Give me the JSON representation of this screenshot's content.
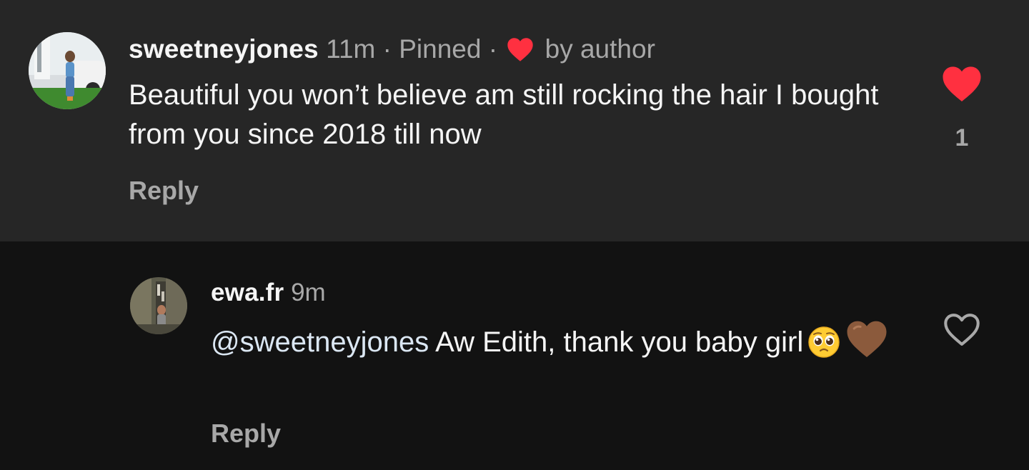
{
  "pinned_comment": {
    "username": "sweetneyjones",
    "time": "11m",
    "sep1": "·",
    "pinned_label": "Pinned",
    "sep2": "·",
    "liked_by_author_label": "by author",
    "text": "Beautiful you won’t believe am still rocking the hair I bought from you since 2018 till now",
    "reply_label": "Reply",
    "like_count": "1",
    "liked": true,
    "avatar_icon": "profile-photo"
  },
  "reply_comment": {
    "username": "ewa.fr",
    "time": "9m",
    "mention": "@sweetneyjones",
    "text": " Aw Edith, thank you baby girl",
    "emojis": [
      "pleading-face-emoji",
      "brown-heart-emoji"
    ],
    "reply_label": "Reply",
    "liked": false,
    "avatar_icon": "profile-photo"
  },
  "colors": {
    "pinned_background": "#262626",
    "page_background": "#121212",
    "like_red": "#ff3040",
    "primary_text": "#f5f5f5",
    "secondary_text": "#a8a8a8",
    "brown_heart": "#8b5a3c"
  }
}
